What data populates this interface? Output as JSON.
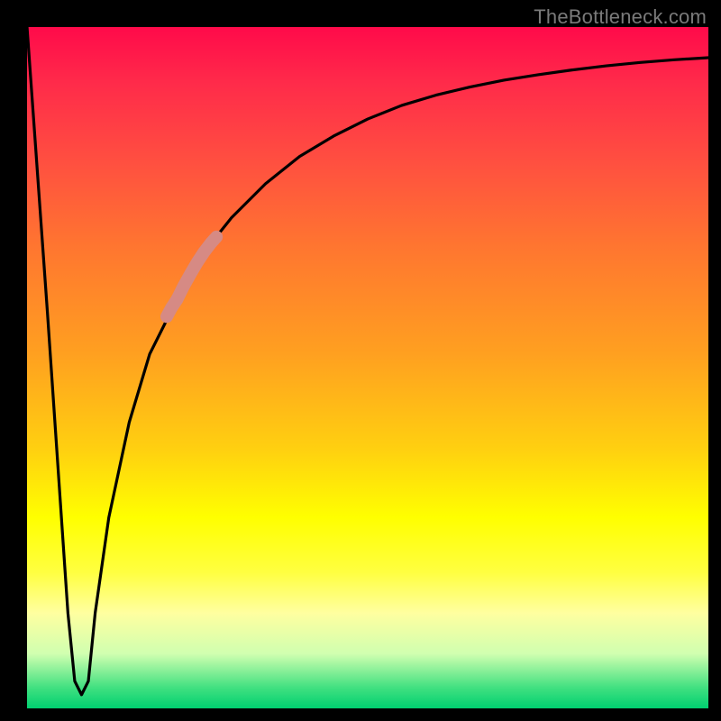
{
  "watermark": "TheBottleneck.com",
  "chart_data": {
    "type": "line",
    "title": "",
    "xlabel": "",
    "ylabel": "",
    "xlim": [
      0,
      100
    ],
    "ylim": [
      0,
      100
    ],
    "series": [
      {
        "name": "main-curve",
        "color": "#000000",
        "x": [
          0,
          3,
          6,
          7,
          8,
          9,
          10,
          12,
          15,
          18,
          22,
          26,
          30,
          35,
          40,
          45,
          50,
          55,
          60,
          65,
          70,
          75,
          80,
          85,
          90,
          95,
          100
        ],
        "values": [
          100,
          58,
          14,
          4,
          2,
          4,
          14,
          28,
          42,
          52,
          60,
          67,
          72,
          77,
          81,
          84,
          86.5,
          88.5,
          90,
          91.2,
          92.2,
          93,
          93.7,
          94.3,
          94.8,
          95.2,
          95.5
        ]
      },
      {
        "name": "highlight-segment-upper",
        "color": "#d68a84",
        "x": [
          22.0,
          23.0,
          24.0,
          25.0,
          26.0,
          27.0,
          27.8
        ],
        "values": [
          60.0,
          62.0,
          63.8,
          65.5,
          67.0,
          68.3,
          69.2
        ]
      },
      {
        "name": "highlight-segment-lower",
        "color": "#d68a84",
        "x": [
          20.5,
          21.2,
          22.0
        ],
        "values": [
          57.5,
          58.8,
          60.0
        ]
      }
    ]
  }
}
